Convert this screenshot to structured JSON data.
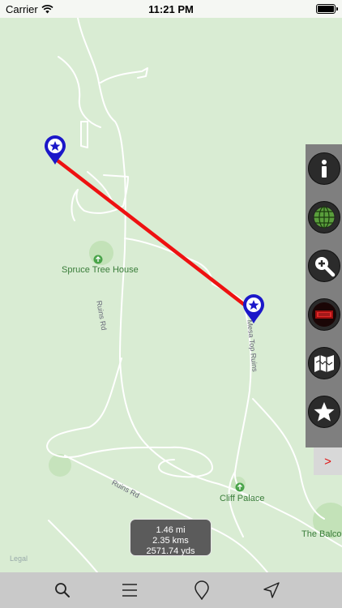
{
  "status_bar": {
    "carrier": "Carrier",
    "time": "11:21 PM"
  },
  "map": {
    "places": [
      {
        "name": "Spruce Tree House"
      },
      {
        "name": "Cliff Palace"
      },
      {
        "name": "The Balcon"
      }
    ],
    "roads": [
      {
        "name": "Ruins Rd"
      },
      {
        "name": "Mesa Top Ruins"
      },
      {
        "name": "Ruins Rd"
      }
    ],
    "legal": "Legal"
  },
  "distance": {
    "miles": "1.46 mi",
    "kilometers": "2.35 kms",
    "yards": "2571.74 yds"
  },
  "side_panel": {
    "buttons": [
      "info-icon",
      "globe-icon",
      "zoom-in-icon",
      "map-layers-icon",
      "folded-map-icon",
      "star-icon"
    ],
    "collapse_label": ">"
  },
  "toolbar": {
    "buttons": [
      "search-icon",
      "list-icon",
      "pin-icon",
      "navigation-arrow-icon"
    ]
  },
  "colors": {
    "measure_line": "#ee1111",
    "marker": "#1b17c9",
    "map_bg": "#d9ecd3"
  }
}
